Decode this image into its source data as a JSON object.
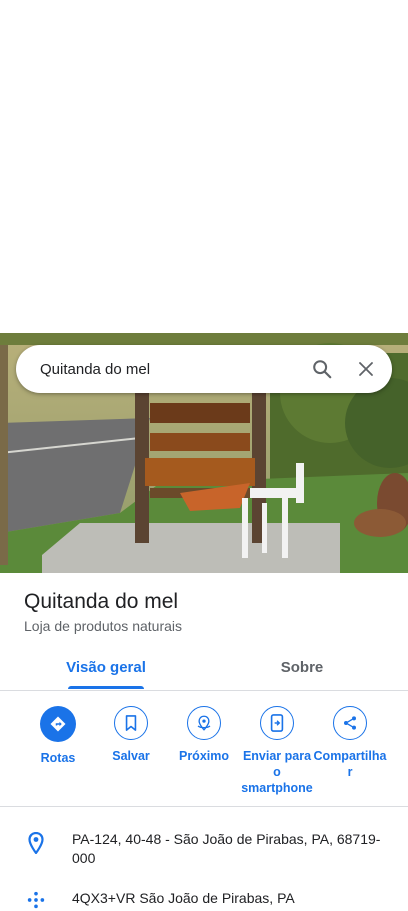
{
  "search": {
    "query": "Quitanda do mel"
  },
  "place": {
    "name": "Quitanda do mel",
    "category": "Loja de produtos naturais"
  },
  "tabs": [
    {
      "label": "Visão geral",
      "selected": true
    },
    {
      "label": "Sobre",
      "selected": false
    }
  ],
  "actions": [
    {
      "label": "Rotas",
      "icon": "directions-icon"
    },
    {
      "label": "Salvar",
      "icon": "bookmark-icon"
    },
    {
      "label": "Próximo",
      "icon": "nearby-icon"
    },
    {
      "label": "Enviar para o smartphone",
      "icon": "send-to-phone-icon"
    },
    {
      "label": "Compartilhar",
      "icon": "share-icon"
    }
  ],
  "info": {
    "address": "PA-124, 40-48 - São João de Pirabas, PA, 68719-000",
    "plus_code": "4QX3+VR São João de Pirabas, PA"
  },
  "colors": {
    "accent": "#1a73e8",
    "secondary_text": "#5f6368",
    "divider": "#dadce0"
  }
}
